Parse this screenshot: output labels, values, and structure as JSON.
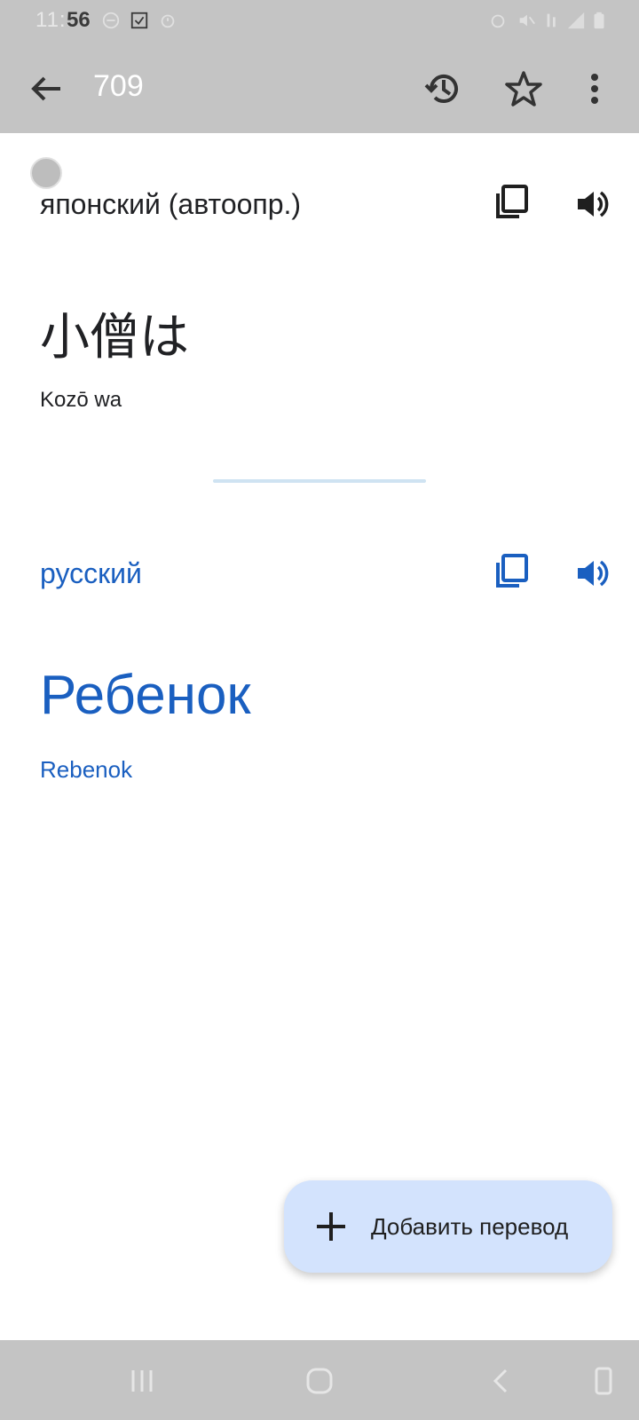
{
  "status_bar": {
    "time": "11:56",
    "time_overlay": "56",
    "icons_left": [
      "minus-circle-icon",
      "check-box-icon",
      "alarm-icon"
    ],
    "icons_right": [
      "alarm-icon",
      "mute-icon",
      "signal-icon",
      "signal-bars-icon",
      "battery-icon"
    ]
  },
  "app_bar": {
    "title": "709",
    "icons": [
      "back-arrow-icon",
      "history-icon",
      "star-icon",
      "more-vert-icon"
    ]
  },
  "source": {
    "language": "японский (автоопр.)",
    "text": "小僧は",
    "transliteration": "Kozō wa"
  },
  "target": {
    "language": "русский",
    "text": "Ребенок",
    "transliteration": "Rebenok"
  },
  "fab": {
    "label": "Добавить перевод",
    "icon": "plus-icon"
  },
  "nav_bar": {
    "icons": [
      "recent-apps-icon",
      "home-icon",
      "back-icon",
      "rotate-icon"
    ]
  },
  "colors": {
    "accent": "#1a5fc0",
    "bars": "#c4c4c4",
    "fab_bg": "#d3e3fd",
    "text_dark": "#202124"
  }
}
